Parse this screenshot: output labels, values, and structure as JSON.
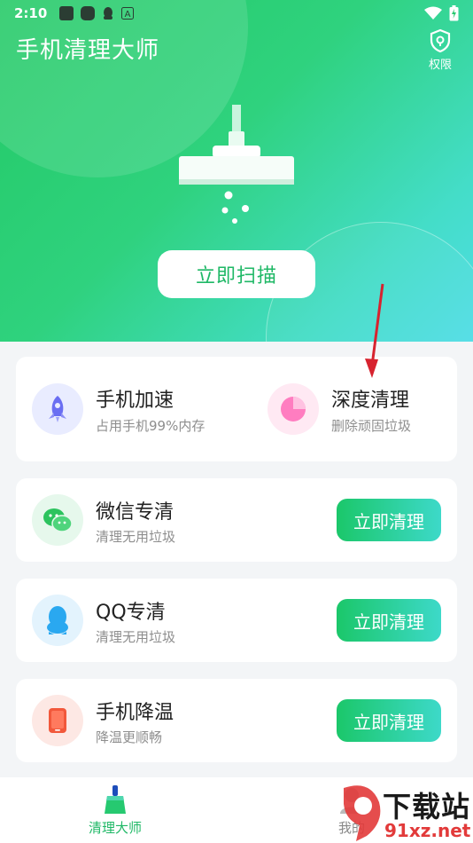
{
  "status_bar": {
    "time": "2:10"
  },
  "header": {
    "title": "手机清理大师",
    "permission_label": "权限"
  },
  "hero": {
    "scan_button": "立即扫描"
  },
  "features": [
    {
      "title": "手机加速",
      "subtitle": "占用手机99%内存",
      "icon": "rocket-icon",
      "color": "#6a6ef2"
    },
    {
      "title": "深度清理",
      "subtitle": "删除顽固垃圾",
      "icon": "pie-chart-icon",
      "color": "#ff6fb4"
    }
  ],
  "rows": [
    {
      "title": "微信专清",
      "subtitle": "清理无用垃圾",
      "button": "立即清理",
      "icon": "wechat-icon",
      "color": "#2cc35e"
    },
    {
      "title": "QQ专清",
      "subtitle": "清理无用垃圾",
      "button": "立即清理",
      "icon": "qq-penguin-icon",
      "color": "#2aa8f0"
    },
    {
      "title": "手机降温",
      "subtitle": "降温更顺畅",
      "button": "立即清理",
      "icon": "phone-cool-icon",
      "color": "#f2583b"
    }
  ],
  "tabbar": {
    "tab_clean": "清理大师",
    "tab_mine": "我的"
  },
  "watermark": {
    "text": "下载站",
    "url": "91xz.net"
  },
  "colors": {
    "accent": "#1fb866",
    "hero_start": "#23c965",
    "hero_end": "#4fdde6"
  }
}
